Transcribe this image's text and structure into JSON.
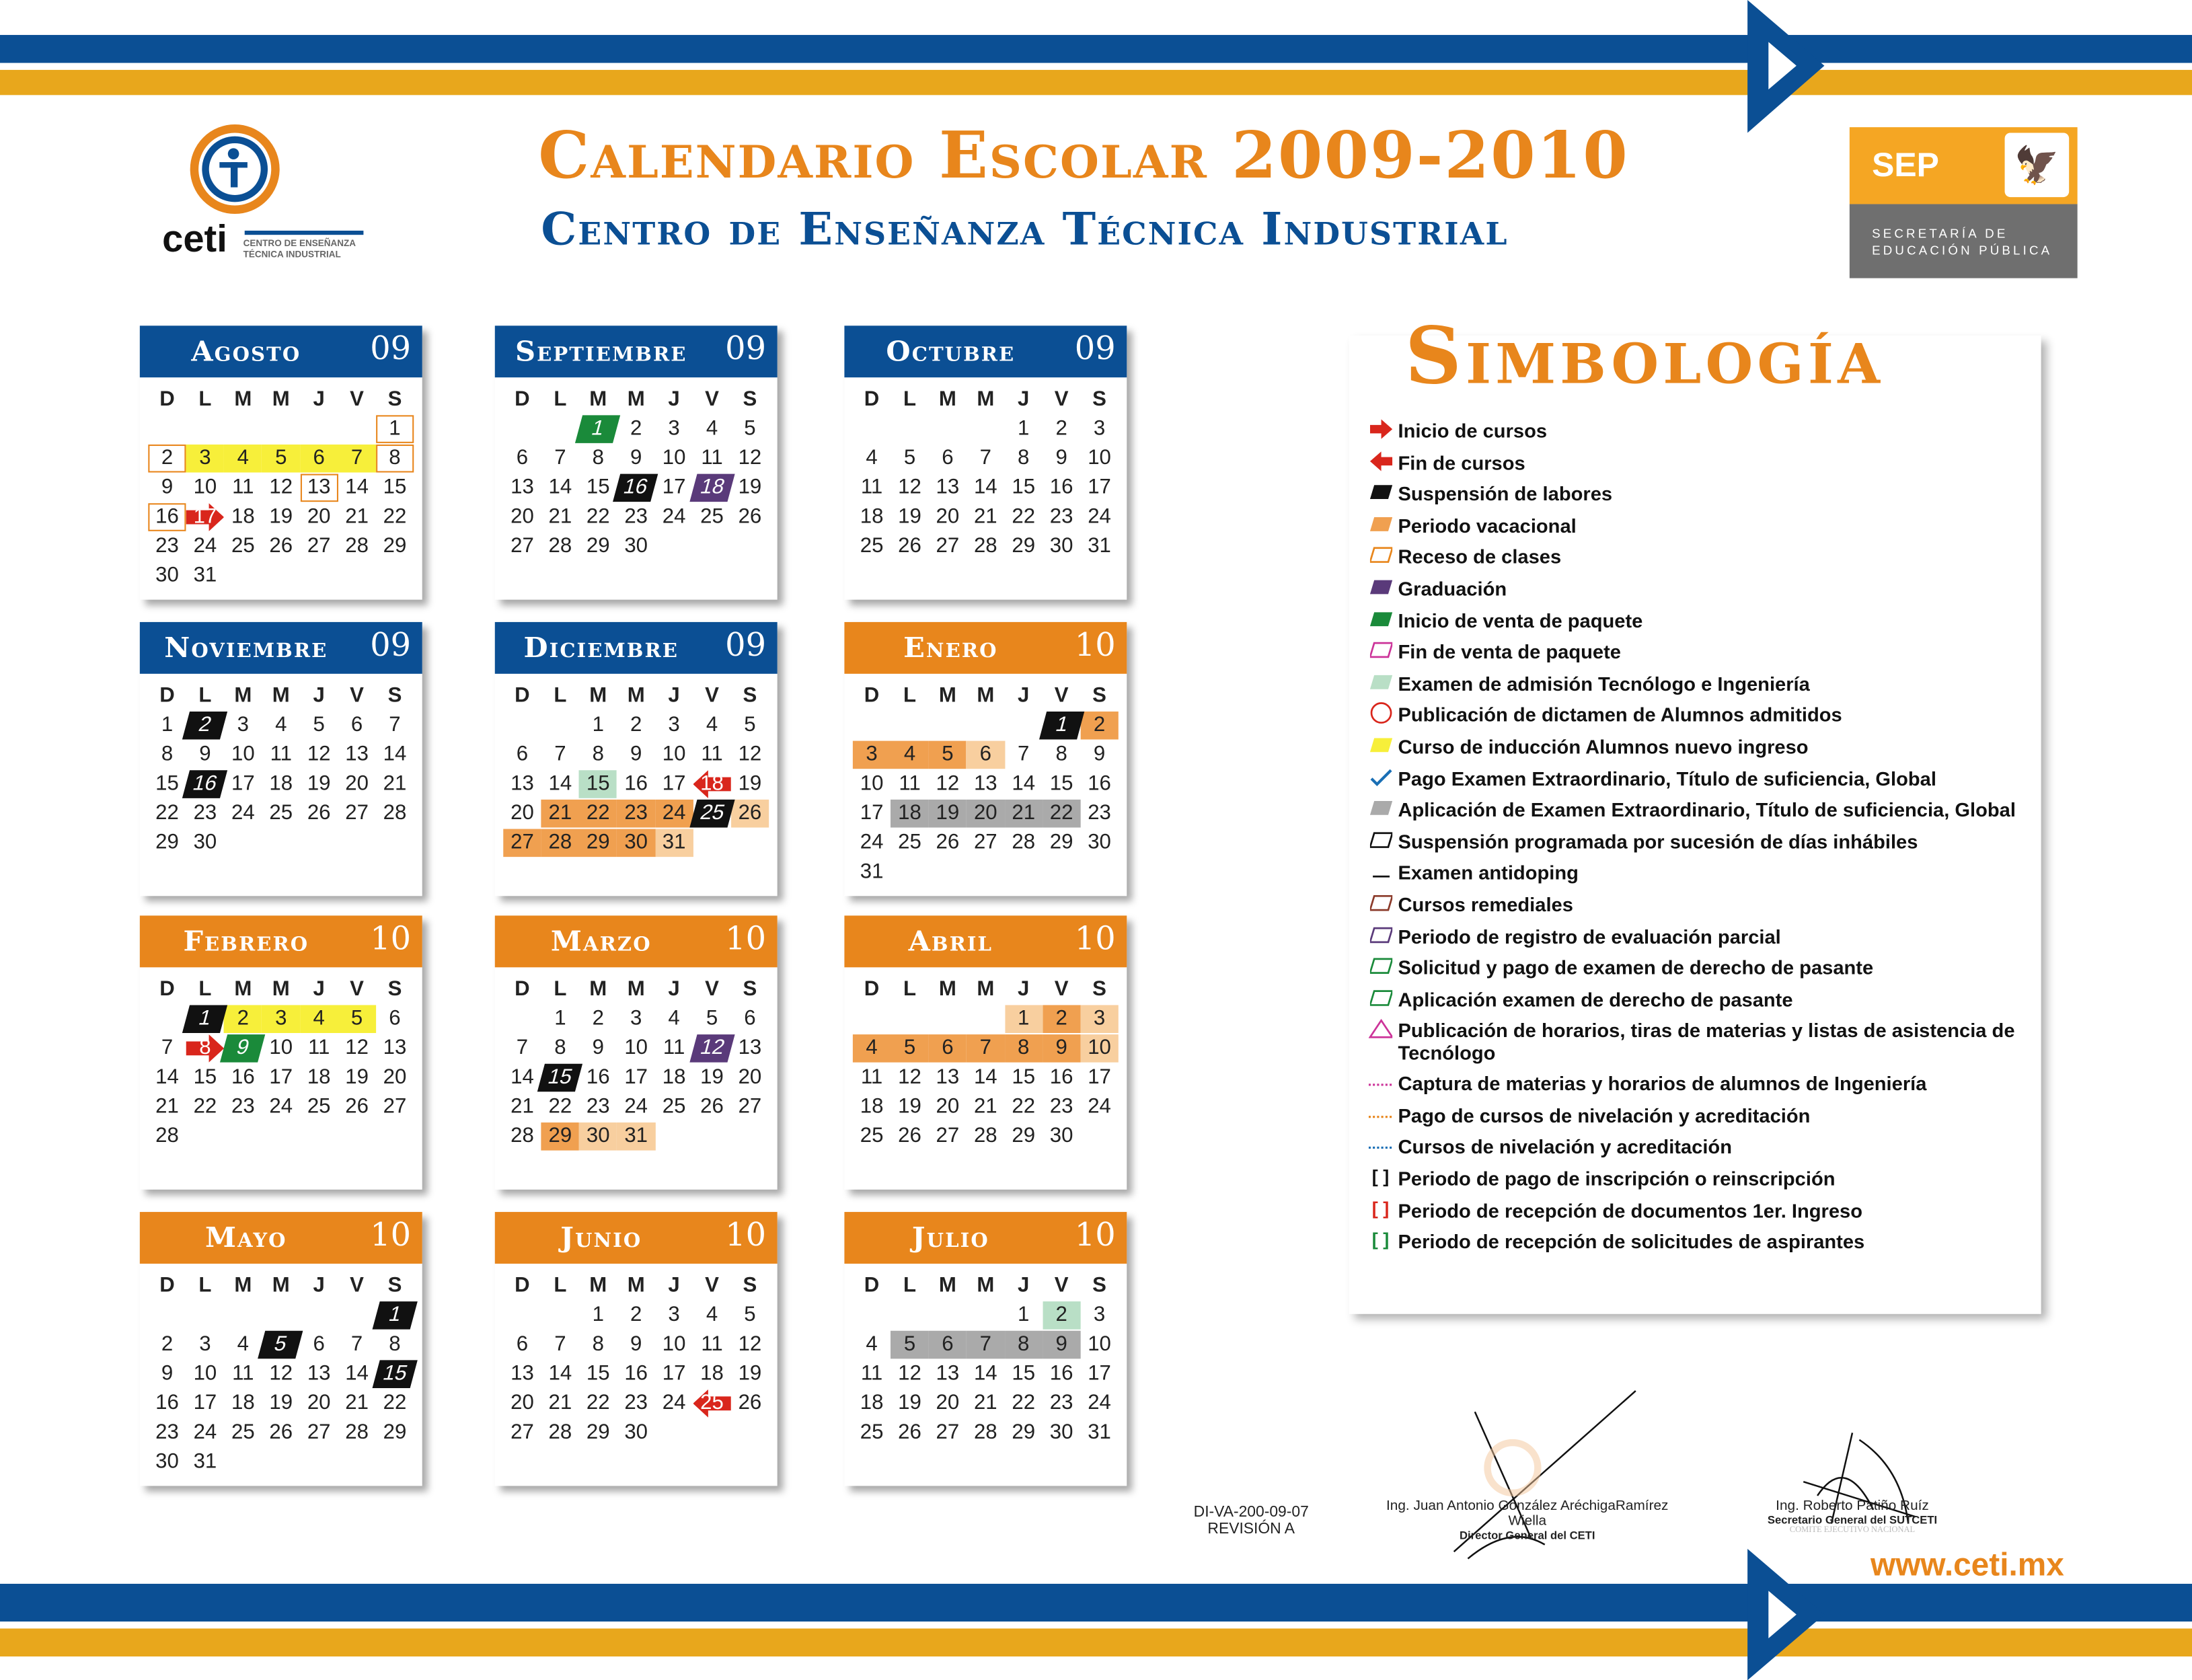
{
  "header": {
    "title": "Calendario Escolar 2009-2010",
    "subtitle": "Centro de Enseñanza Técnica Industrial",
    "logo_text": "ceti",
    "logo_sub1": "CENTRO DE ENSEÑANZA",
    "logo_sub2": "TÉCNICA INDUSTRIAL",
    "sep_label": "SEP",
    "sep_line1": "SECRETARÍA DE",
    "sep_line2": "EDUCACIÓN PÚBLICA"
  },
  "colors": {
    "blue": "#0b4f94",
    "orange": "#e8861c",
    "gold": "#e8a71c"
  },
  "weekdays": [
    "D",
    "L",
    "M",
    "M",
    "J",
    "V",
    "S"
  ],
  "months": [
    {
      "name": "Agosto",
      "year": "09",
      "start": 6,
      "days": 31,
      "header": "blue",
      "marks": {
        "1": "rcs",
        "2": "rcs",
        "3": "yel",
        "4": "yel",
        "5": "yel",
        "6": "yel",
        "7": "yel",
        "8": "rcs",
        "13": "rcs",
        "16": "rcs",
        "17": "red"
      }
    },
    {
      "name": "Septiembre",
      "year": "09",
      "start": 2,
      "days": 30,
      "header": "blue",
      "marks": {
        "1": "grn",
        "16": "blk",
        "18": "pur"
      }
    },
    {
      "name": "Octubre",
      "year": "09",
      "start": 4,
      "days": 31,
      "header": "blue",
      "marks": {}
    },
    {
      "name": "Noviembre",
      "year": "09",
      "start": 0,
      "days": 30,
      "header": "blue",
      "marks": {
        "2": "blk",
        "16": "blk"
      }
    },
    {
      "name": "Diciembre",
      "year": "09",
      "start": 2,
      "days": 31,
      "header": "blue",
      "marks": {
        "15": "lgr",
        "18": "fin",
        "21": "vac",
        "22": "vac",
        "23": "vac",
        "24": "vac",
        "25": "blk",
        "26": "vacl",
        "27": "vac",
        "28": "vac",
        "29": "vac",
        "30": "vac",
        "31": "vacl"
      }
    },
    {
      "name": "Enero",
      "year": "10",
      "start": 5,
      "days": 31,
      "header": "orange",
      "marks": {
        "1": "blk",
        "2": "vac",
        "3": "vac",
        "4": "vac",
        "5": "vac",
        "6": "vacl",
        "18": "gry",
        "19": "gry",
        "20": "gry",
        "21": "gry",
        "22": "gry"
      }
    },
    {
      "name": "Febrero",
      "year": "10",
      "start": 1,
      "days": 28,
      "header": "orange",
      "marks": {
        "1": "blk",
        "2": "yel",
        "3": "yel",
        "4": "yel",
        "5": "yel",
        "8": "red",
        "9": "grn"
      }
    },
    {
      "name": "Marzo",
      "year": "10",
      "start": 1,
      "days": 31,
      "header": "orange",
      "marks": {
        "12": "pur",
        "15": "blk",
        "29": "vac",
        "30": "vacl",
        "31": "vacl"
      }
    },
    {
      "name": "Abril",
      "year": "10",
      "start": 4,
      "days": 30,
      "header": "orange",
      "marks": {
        "1": "vacl",
        "2": "vac",
        "3": "vacl",
        "4": "vac",
        "5": "vac",
        "6": "vac",
        "7": "vac",
        "8": "vac",
        "9": "vac",
        "10": "vacl"
      }
    },
    {
      "name": "Mayo",
      "year": "10",
      "start": 6,
      "days": 31,
      "header": "orange",
      "marks": {
        "1": "blk",
        "5": "blk",
        "15": "blk"
      }
    },
    {
      "name": "Junio",
      "year": "10",
      "start": 2,
      "days": 30,
      "header": "orange",
      "marks": {
        "25": "fin"
      }
    },
    {
      "name": "Julio",
      "year": "10",
      "start": 4,
      "days": 31,
      "header": "orange",
      "marks": {
        "2": "lgr",
        "5": "gry",
        "6": "gry",
        "7": "gry",
        "8": "gry",
        "9": "gry"
      }
    }
  ],
  "legend": {
    "title": "Simbología",
    "items": [
      {
        "sym": "arrow-right",
        "color": "#d9261c",
        "label": "Inicio de cursos"
      },
      {
        "sym": "arrow-left",
        "color": "#d9261c",
        "label": "Fin de cursos"
      },
      {
        "sym": "fill",
        "color": "#111111",
        "label": "Suspensión de labores"
      },
      {
        "sym": "fill",
        "color": "#f0a050",
        "label": "Periodo vacacional"
      },
      {
        "sym": "box",
        "color": "#e8861c",
        "label": "Receso de clases"
      },
      {
        "sym": "fill",
        "color": "#5a3a7a",
        "label": "Graduación"
      },
      {
        "sym": "fill",
        "color": "#1a8a3a",
        "label": "Inicio de venta de paquete"
      },
      {
        "sym": "box",
        "color": "#cc3399",
        "label": "Fin de venta de paquete"
      },
      {
        "sym": "fill",
        "color": "#b9dfc6",
        "label": "Examen de admisión Tecnólogo e Ingeniería"
      },
      {
        "sym": "circle",
        "color": "#d9261c",
        "label": "Publicación de dictamen de Alumnos admitidos"
      },
      {
        "sym": "fill",
        "color": "#f7ef3a",
        "label": "Curso de inducción Alumnos nuevo ingreso"
      },
      {
        "sym": "check",
        "color": "#1a6fb5",
        "label": "Pago Examen Extraordinario, Título de suficiencia, Global"
      },
      {
        "sym": "fill",
        "color": "#aaaaaa",
        "label": "Aplicación de Examen Extraordinario, Título de suficiencia, Global"
      },
      {
        "sym": "box",
        "color": "#111111",
        "label": "Suspensión programada por sucesión de días inhábiles"
      },
      {
        "sym": "line",
        "color": "#111111",
        "label": "Examen antidoping"
      },
      {
        "sym": "box",
        "color": "#8b3a2a",
        "label": "Cursos remediales"
      },
      {
        "sym": "box",
        "color": "#5a3a7a",
        "label": "Periodo de registro de evaluación parcial"
      },
      {
        "sym": "box",
        "color": "#1a8a3a",
        "label": "Solicitud y pago de examen de derecho de pasante"
      },
      {
        "sym": "box",
        "color": "#1a8a3a",
        "label": "Aplicación examen de derecho de pasante"
      },
      {
        "sym": "triangle",
        "color": "#cc3399",
        "label": "Publicación de horarios, tiras de materias y listas de asistencia de Tecnólogo"
      },
      {
        "sym": "dots",
        "color": "#cc3399",
        "label": "Captura de materias y horarios de alumnos de Ingeniería"
      },
      {
        "sym": "dots",
        "color": "#e8861c",
        "label": "Pago de cursos de nivelación y acreditación"
      },
      {
        "sym": "dots",
        "color": "#1a6fb5",
        "label": "Cursos de nivelación y acreditación"
      },
      {
        "sym": "bracket",
        "color": "#111111",
        "label": "Periodo de pago de inscripción o reinscripción"
      },
      {
        "sym": "bracket",
        "color": "#d9261c",
        "label": "Periodo de recepción de documentos 1er. Ingreso"
      },
      {
        "sym": "bracket",
        "color": "#1a8a3a",
        "label": "Periodo de recepción de solicitudes de aspirantes"
      }
    ]
  },
  "footer": {
    "doc_code": "DI-VA-200-09-07",
    "revision": "REVISIÓN A",
    "sig1_name": "Ing. Juan Antonio González AréchigaRamírez Wiella",
    "sig1_title": "Director General del CETI",
    "sig2_name": "Ing. Roberto Patiño Ruíz",
    "sig2_title": "Secretario General del SUTCETI",
    "sig2_stamp": "COMITE EJECUTIVO NACIONAL",
    "website": "www.ceti.mx"
  }
}
